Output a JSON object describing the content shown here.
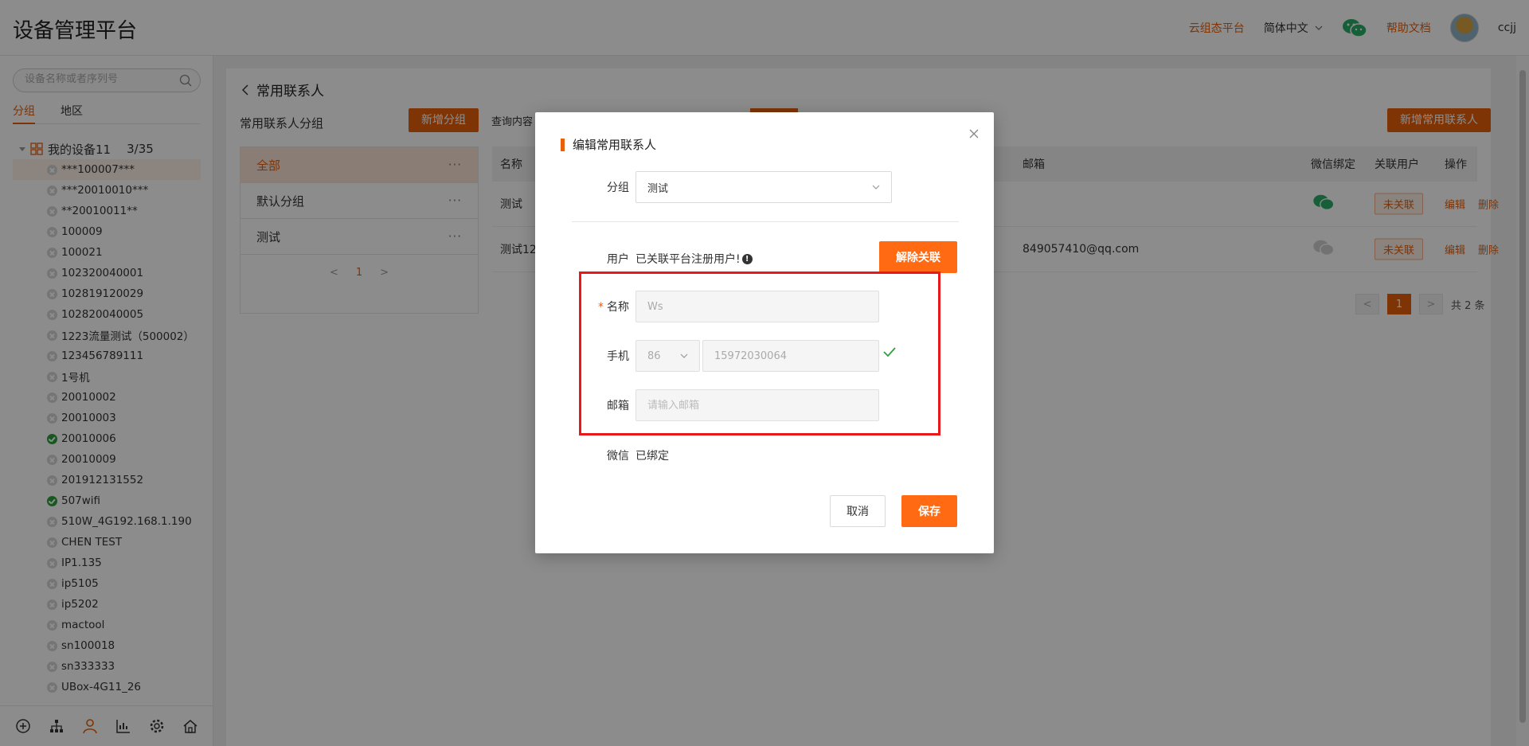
{
  "app": {
    "title": "设备管理平台"
  },
  "header": {
    "cloud_link": "云组态平台",
    "language": "简体中文",
    "help_link": "帮助文档",
    "username": "ccjj"
  },
  "sidebar": {
    "search_placeholder": "设备名称或者序列号",
    "tabs": [
      "分组",
      "地区"
    ],
    "root": {
      "label": "我的设备11",
      "count": "3/35"
    },
    "items": [
      {
        "label": "***100007***",
        "online": false,
        "selected": true
      },
      {
        "label": "***20010010***",
        "online": false
      },
      {
        "label": "**20010011**",
        "online": false
      },
      {
        "label": "100009",
        "online": false
      },
      {
        "label": "100021",
        "online": false
      },
      {
        "label": "102320040001",
        "online": false
      },
      {
        "label": "102819120029",
        "online": false
      },
      {
        "label": "102820040005",
        "online": false
      },
      {
        "label": "1223流量测试（500002）",
        "online": false
      },
      {
        "label": "123456789111",
        "online": false
      },
      {
        "label": "1号机",
        "online": false
      },
      {
        "label": "20010002",
        "online": false
      },
      {
        "label": "20010003",
        "online": false
      },
      {
        "label": "20010006",
        "online": true
      },
      {
        "label": "20010009",
        "online": false
      },
      {
        "label": "201912131552",
        "online": false
      },
      {
        "label": "507wifi",
        "online": true
      },
      {
        "label": "510W_4G192.168.1.190",
        "online": false
      },
      {
        "label": "CHEN TEST",
        "online": false
      },
      {
        "label": "IP1.135",
        "online": false
      },
      {
        "label": "ip5105",
        "online": false
      },
      {
        "label": "ip5202",
        "online": false
      },
      {
        "label": "mactool",
        "online": false
      },
      {
        "label": "sn100018",
        "online": false
      },
      {
        "label": "sn333333",
        "online": false
      },
      {
        "label": "UBox-4G11_26",
        "online": false
      }
    ],
    "bottom_icons": [
      "plus-circle-icon",
      "org-tree-icon",
      "user-icon",
      "chart-icon",
      "gear-icon",
      "home-icon"
    ]
  },
  "main": {
    "breadcrumb": "常用联系人",
    "group_title": "常用联系人分组",
    "add_group_button": "新增分组",
    "query_label": "查询内容",
    "add_contact_button": "新增常用联系人",
    "groups": [
      {
        "label": "全部",
        "active": true
      },
      {
        "label": "默认分组",
        "active": false
      },
      {
        "label": "测试",
        "active": false
      }
    ],
    "group_page": "1",
    "columns": {
      "name": "名称",
      "email": "邮箱",
      "wechat": "微信绑定",
      "linked_user": "关联用户",
      "actions": "操作"
    },
    "rows": [
      {
        "name": "测试",
        "email": "",
        "wechat_bound": true,
        "linked": "未关联",
        "edit": "编辑",
        "delete": "删除"
      },
      {
        "name": "测试12",
        "email": "849057410@qq.com",
        "wechat_bound": false,
        "linked": "未关联",
        "edit": "编辑",
        "delete": "删除"
      }
    ],
    "pager": {
      "current": "1",
      "total": "共 2 条"
    }
  },
  "modal": {
    "title": "编辑常用联系人",
    "group_label": "分组",
    "group_value": "测试",
    "user_label": "用户",
    "user_status": "已关联平台注册用户!",
    "unlink_button": "解除关联",
    "name_label": "名称",
    "name_required": "*",
    "name_value": "Ws",
    "phone_label": "手机",
    "country_code": "86",
    "phone_value": "15972030064",
    "email_label": "邮箱",
    "email_placeholder": "请输入邮箱",
    "wechat_label": "微信",
    "wechat_status": "已绑定",
    "cancel_button": "取消",
    "save_button": "保存"
  },
  "colors": {
    "accent": "#e8600c",
    "button": "#ff6a13",
    "highlight": "#e8191a",
    "online": "#2aa13b",
    "wechat": "#2aae67"
  }
}
